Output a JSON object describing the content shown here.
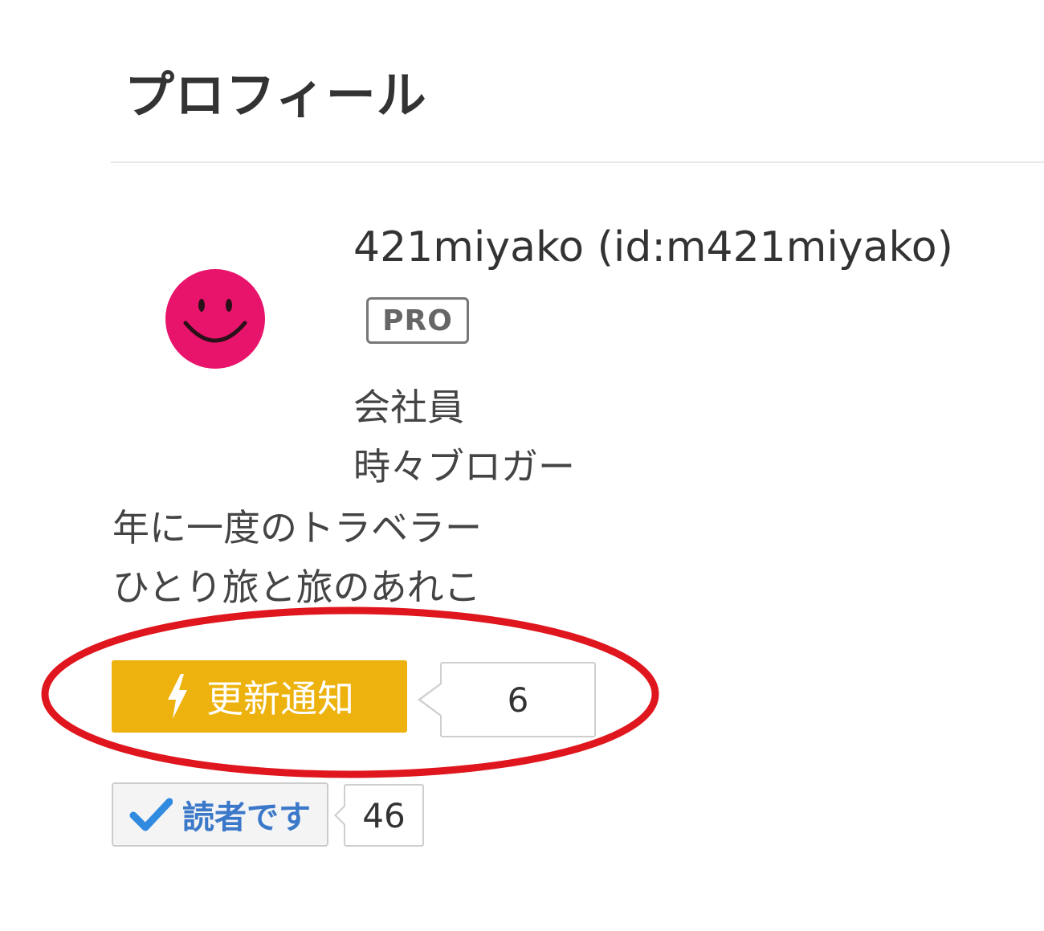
{
  "profile": {
    "heading": "プロフィール",
    "username": "421miyako (id:m421miyako)",
    "pro_badge": "PRO",
    "bio": [
      "会社員",
      "時々ブロガー",
      "年に一度のトラベラー",
      "ひとり旅と旅のあれこ"
    ],
    "avatar_icon": "smiley-face-icon",
    "avatar_color": "#e8146c"
  },
  "actions": {
    "subscribe_label": "更新通知",
    "subscribe_icon": "lightning-icon",
    "subscribe_count": "6",
    "subscribe_color": "#edb20e",
    "reader_label": "読者です",
    "reader_icon": "checkmark-icon",
    "reader_count": "46",
    "reader_color": "#3b78c9"
  },
  "annotation": {
    "shape": "ellipse",
    "color": "#e0161e"
  }
}
